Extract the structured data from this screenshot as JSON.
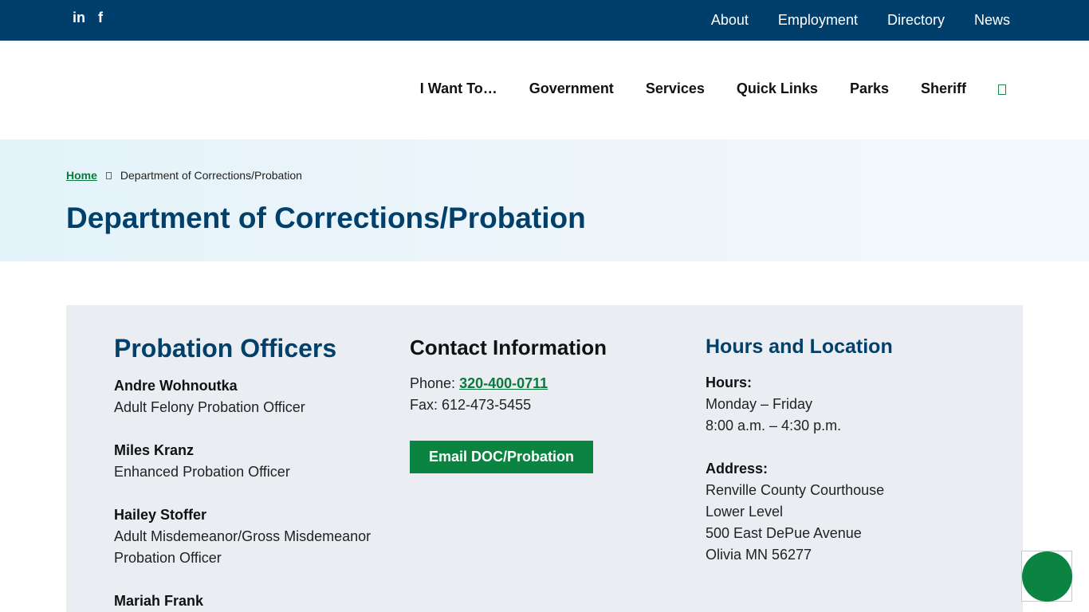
{
  "topbar": {
    "social": [
      {
        "label": "in",
        "icon": "linkedin-icon"
      },
      {
        "label": "f",
        "icon": "facebook-icon"
      }
    ],
    "links": [
      "About",
      "Employment",
      "Directory",
      "News"
    ]
  },
  "mainnav": {
    "items": [
      "I Want To…",
      "Government",
      "Services",
      "Quick Links",
      "Parks",
      "Sheriff"
    ],
    "search_icon": "search-icon"
  },
  "hero": {
    "breadcrumb_home": "Home",
    "breadcrumb_current": "Department of Corrections/Probation",
    "title": "Department of Corrections/Probation"
  },
  "officers": {
    "heading": "Probation Officers",
    "list": [
      {
        "name": "Andre Wohnoutka",
        "role": "Adult Felony Probation Officer"
      },
      {
        "name": "Miles Kranz",
        "role": "Enhanced Probation Officer"
      },
      {
        "name": "Hailey Stoffer",
        "role": "Adult Misdemeanor/Gross Misdemeanor Probation Officer"
      },
      {
        "name": "Mariah Frank",
        "role": ""
      }
    ]
  },
  "contact": {
    "heading": "Contact Information",
    "phone_label": "Phone: ",
    "phone": "320-400-0711",
    "fax": "Fax: 612-473-5455",
    "email_button": "Email DOC/Probation"
  },
  "hours": {
    "heading": "Hours and Location",
    "hours_label": "Hours:",
    "days": "Monday – Friday",
    "time": "8:00 a.m. – 4:30 p.m.",
    "address_label": "Address:",
    "address": [
      "Renville County Courthouse",
      "Lower Level",
      "500 East DePue Avenue",
      "Olivia MN 56277"
    ]
  },
  "colors": {
    "navy": "#003f6b",
    "title_blue": "#00406a",
    "green": "#0b8442",
    "panel": "#eaeef2"
  }
}
